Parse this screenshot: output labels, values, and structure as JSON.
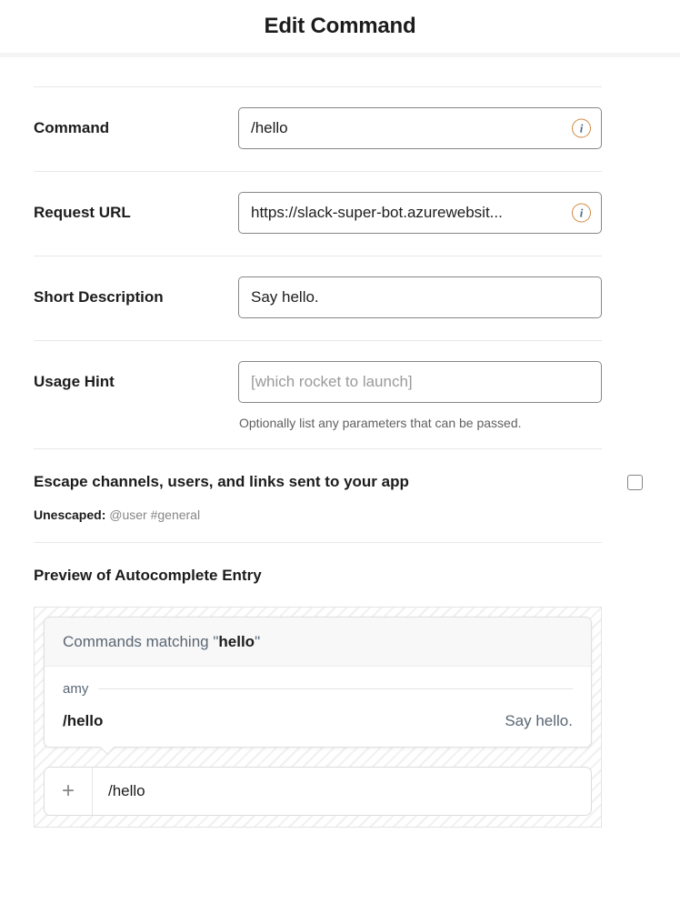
{
  "header": {
    "title": "Edit Command"
  },
  "fields": [
    {
      "label": "Command",
      "value": "/hello",
      "placeholder": "",
      "info_icon": "info-icon",
      "help": ""
    },
    {
      "label": "Request URL",
      "value": "https://slack-super-bot.azurewebsit...",
      "placeholder": "",
      "info_icon": "info-icon",
      "help": ""
    },
    {
      "label": "Short Description",
      "value": "Say hello.",
      "placeholder": "",
      "info_icon": "",
      "help": ""
    },
    {
      "label": "Usage Hint",
      "value": "",
      "placeholder": "[which rocket to launch]",
      "info_icon": "",
      "help": "Optionally list any parameters that can be passed."
    }
  ],
  "escape": {
    "label": "Escape channels, users, and links sent to your app",
    "checked": false,
    "unescaped_label": "Unescaped:",
    "unescaped_value": "@user #general"
  },
  "preview": {
    "heading": "Preview of Autocomplete Entry",
    "autocomplete": {
      "header_prefix": "Commands matching \"",
      "header_term": "hello",
      "header_suffix": "\"",
      "group_name": "amy",
      "item_command": "/hello",
      "item_description": "Say hello."
    },
    "message_input": {
      "plus_icon": "plus-icon",
      "value": "/hello"
    }
  },
  "colors": {
    "text_primary": "#1d1c1d",
    "text_muted": "#5a6673",
    "border": "#868686",
    "divider": "#e8e8e8",
    "info_ring": "#d08a45",
    "info_glyph": "#4a6b88"
  }
}
